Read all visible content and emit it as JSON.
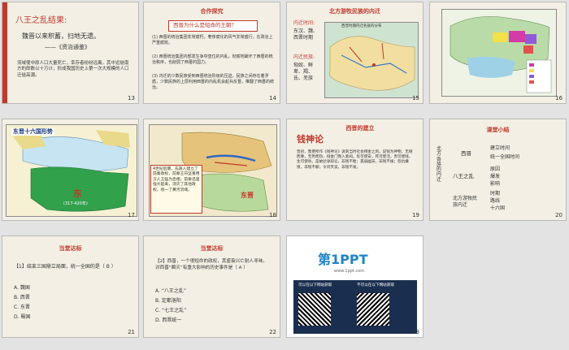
{
  "slides": {
    "s13": {
      "num": "13",
      "title": "八王之乱结果:",
      "line1": "魏晋以来积蓄，扫地无遗。",
      "line2": "——《资治通鉴》",
      "para": "流域使中原人口大量死亡，幸存者纷纷远离。其中远徙南方的即数以十万计，形成我国历史上第一次大规模的人口迁徙高潮。"
    },
    "s14": {
      "num": "14",
      "header": "合作探究",
      "question": "西晋为什么是短命的王朝？",
      "p1": "(1) 西晋的统治集团非常腐朽，奢侈腐化的风气非常盛行，在政治上严重腐败。",
      "p2": "(2) 西晋统治集团内部发生争夺皇位的内乱，彻底地破坏了西晋的统治秩序，也削弱了西晋的国力。",
      "p3": "(3) 内迁的少数民族受到西晋统治阶级的压迫，民族之间存在着矛盾，少数民族的上层利用西晋的内乱机会起兵反晋，推翻了西晋的统治。"
    },
    "s15": {
      "num": "15",
      "header": "北方游牧民族的内迁",
      "lbl_time": "内迁时间:",
      "time": "东汉、魏、西晋时期",
      "lbl_groups": "内迁民族:",
      "groups": "匈奴、鲜卑、羯、氐、羌族",
      "map_title": "西晋时期内迁各族的分布"
    },
    "s16": {
      "num": "16"
    },
    "s17": {
      "num": "17",
      "title": "东晋十六国形势",
      "kingdom": "东",
      "ad": "(317-420年)"
    },
    "s18": {
      "num": "18",
      "callout": "4世纪后期，氐族人建立了前秦政权，前秦王苻坚重用汉人王猛为丞相，前秦迅速强大起来，消灭了其他政权，统一了黄河流域。",
      "state": "东晋"
    },
    "s19": {
      "num": "19",
      "big": "钱神论",
      "header": "西晋的建立",
      "para": "晋初，鲁褒所作《钱神论》讽刺当时社会拜金之风，说钱为神物，无德而尊，无势而热，排金门而入紫闼。危可使安，死可使活，贵可使贱，生可使杀。是故忿诤辩讼，非钱不胜；孤弱幽滞，非钱不拔；怨仇嫌恨，非钱不解；令问笑谈，非钱不发。"
    },
    "s20": {
      "num": "20",
      "header": "课堂小结",
      "root": "北方各族的内迁",
      "b1": "西晋",
      "b1a": "建立时间",
      "b1b": "统一全国时间",
      "b2": "八王之乱",
      "b2a": "原因",
      "b2b": "爆发",
      "b2c": "影响",
      "b3": "北方游牧民族内迁",
      "b3a": "时期",
      "b3b": "路线",
      "b3c": "十六国"
    },
    "s21": {
      "num": "21",
      "header": "当堂达标",
      "q": "【1】结束三国鼎立局面，统一全国的是（ B ）",
      "a": "A. 魏国",
      "b": "B. 西晋",
      "c": "C. 东晋",
      "d": "D. 蜀国"
    },
    "s22": {
      "num": "22",
      "header": "当堂达标",
      "q": "【2】西晋，一个很短命的政权，其盛衰兴亡耐人寻味。对西晋“瞬灭”有重大影响的历史事件是（ A ）",
      "a": "A. “八王之乱”",
      "b": "B. 定都洛阳",
      "c": "C. “七王之乱”",
      "d": "D. 西晋统一"
    },
    "s23": {
      "num": "23",
      "logo": "第1PPT",
      "url": "www.1ppt.com",
      "left_cap": "可以在以下网站获取",
      "right_cap": "不可以在以下网站获取"
    }
  }
}
